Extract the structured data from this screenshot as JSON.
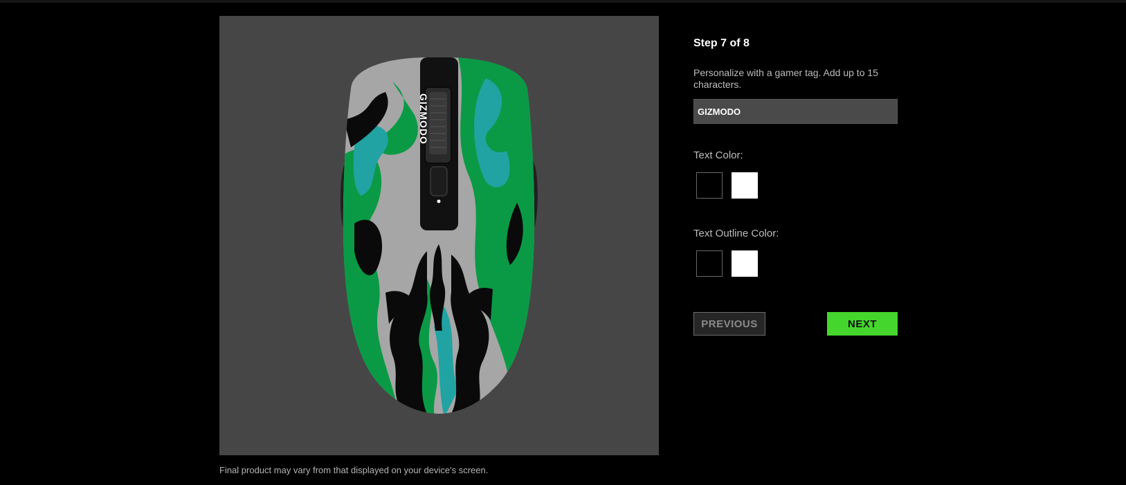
{
  "preview": {
    "mouse_tag_text": "GIZMODO",
    "colors": {
      "background": "#464646",
      "green": "#0a9a45",
      "teal": "#21a3a3",
      "silver": "#a6a6a6",
      "black": "#0a0a0a"
    },
    "icon": "mouse-skin-preview",
    "disclaimer": "Final product may vary from that displayed on your device's screen."
  },
  "panel": {
    "step": "Step 7 of 8",
    "prompt": "Personalize with a gamer tag. Add up to 15 characters.",
    "tag_input": {
      "value": "GIZMODO",
      "placeholder": ""
    },
    "text_color": {
      "label": "Text Color:",
      "options": [
        {
          "name": "black",
          "hex": "#000000"
        },
        {
          "name": "white",
          "hex": "#FFFFFF"
        }
      ]
    },
    "outline_color": {
      "label": "Text Outline Color:",
      "options": [
        {
          "name": "black",
          "hex": "#000000"
        },
        {
          "name": "white",
          "hex": "#FFFFFF"
        }
      ]
    },
    "buttons": {
      "previous": "PREVIOUS",
      "next": "NEXT"
    },
    "accent": "#44D62C"
  }
}
